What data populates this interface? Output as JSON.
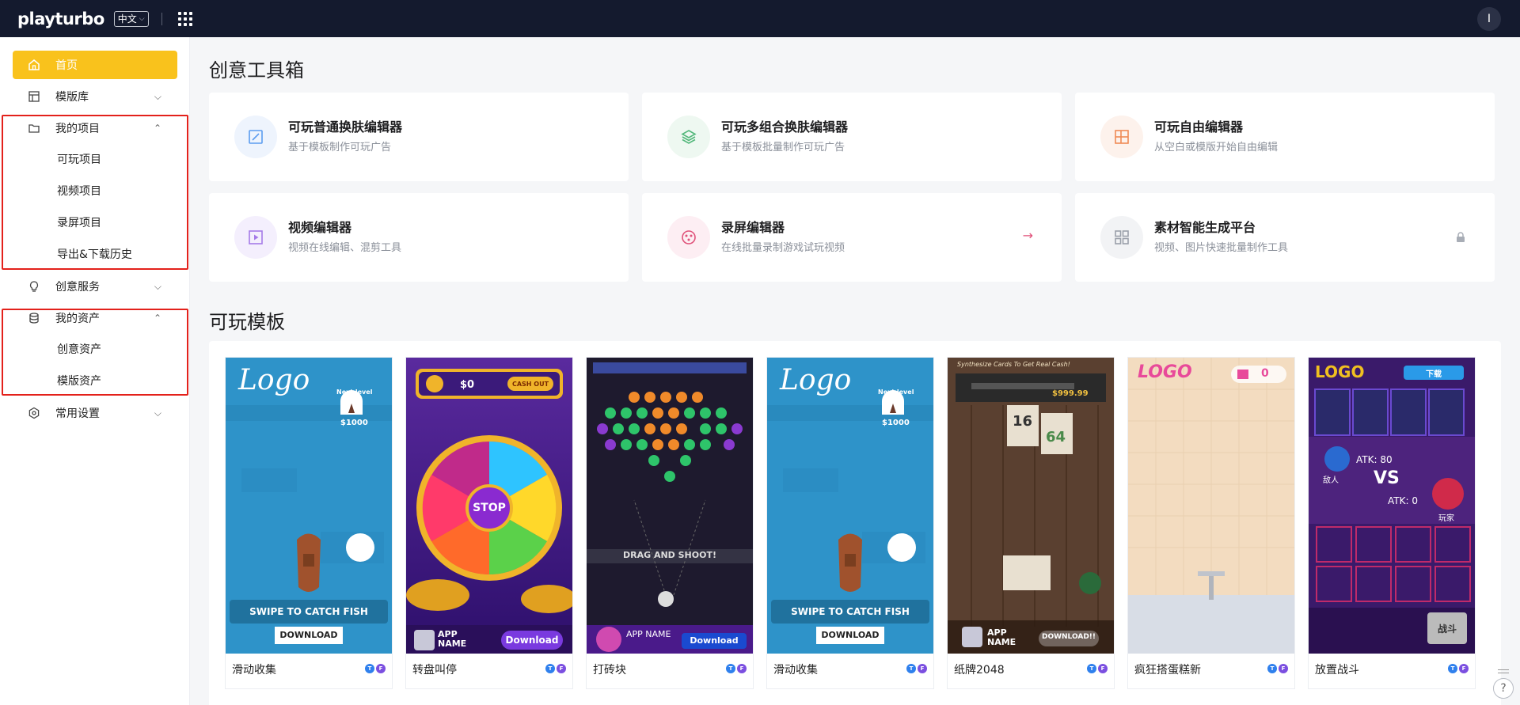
{
  "topbar": {
    "logo": "playturbo",
    "lang": "中文",
    "avatar_letter": "I"
  },
  "sidebar": {
    "home": "首页",
    "templates": "模版库",
    "my_projects": "我的项目",
    "projects_sub": [
      "可玩项目",
      "视频项目",
      "录屏项目",
      "导出&下载历史"
    ],
    "creative_services": "创意服务",
    "my_assets": "我的资产",
    "assets_sub": [
      "创意资产",
      "模版资产"
    ],
    "settings": "常用设置"
  },
  "main": {
    "toolbox_title": "创意工具箱",
    "tools": [
      {
        "name": "可玩普通换肤编辑器",
        "desc": "基于模板制作可玩广告",
        "icon": "edit-square-icon"
      },
      {
        "name": "可玩多组合换肤编辑器",
        "desc": "基于模板批量制作可玩广告",
        "icon": "layers-icon"
      },
      {
        "name": "可玩自由编辑器",
        "desc": "从空白或模版开始自由编辑",
        "icon": "layout-icon"
      },
      {
        "name": "视频编辑器",
        "desc": "视频在线编辑、混剪工具",
        "icon": "play-square-icon"
      },
      {
        "name": "录屏编辑器",
        "desc": "在线批量录制游戏试玩视频",
        "icon": "gamepad-icon"
      },
      {
        "name": "素材智能生成平台",
        "desc": "视频、图片快速批量制作工具",
        "icon": "grid-icon"
      }
    ],
    "arrow": "→",
    "templates_title": "可玩模板",
    "templates": [
      {
        "name": "滑动收集",
        "caption": "SWIPE TO CATCH FISH",
        "button": "DOWNLOAD",
        "money": "$1000",
        "next": "Next level",
        "logo": "Logo"
      },
      {
        "name": "转盘叫停",
        "caption": "STOP",
        "button": "Download",
        "money": "$0",
        "cash": "CASH OUT",
        "app": "APP NAME"
      },
      {
        "name": "打砖块",
        "caption": "DRAG AND SHOOT!",
        "button": "Download",
        "app": "APP NAME"
      },
      {
        "name": "滑动收集",
        "caption": "SWIPE TO CATCH FISH",
        "button": "DOWNLOAD",
        "money": "$1000",
        "next": "Next level",
        "logo": "Logo"
      },
      {
        "name": "纸牌2048",
        "caption": "Synthesize Cards To Get Real Cash!",
        "button": "DOWNLOAD!!",
        "money": "$999.99",
        "app": "APP NAME"
      },
      {
        "name": "疯狂搭蛋糕新",
        "caption": "LOGO",
        "count": "0"
      },
      {
        "name": "放置战斗",
        "caption": "VS",
        "button": "下载",
        "logo": "LOGO",
        "atk1": "ATK: 80",
        "atk2": "ATK: 0",
        "enemy": "敌人",
        "player": "玩家",
        "fight": "战斗"
      }
    ]
  },
  "colors": {
    "topbar": "#141a2e",
    "accent": "#f9c21c",
    "highlight_box": "#e3211b"
  }
}
